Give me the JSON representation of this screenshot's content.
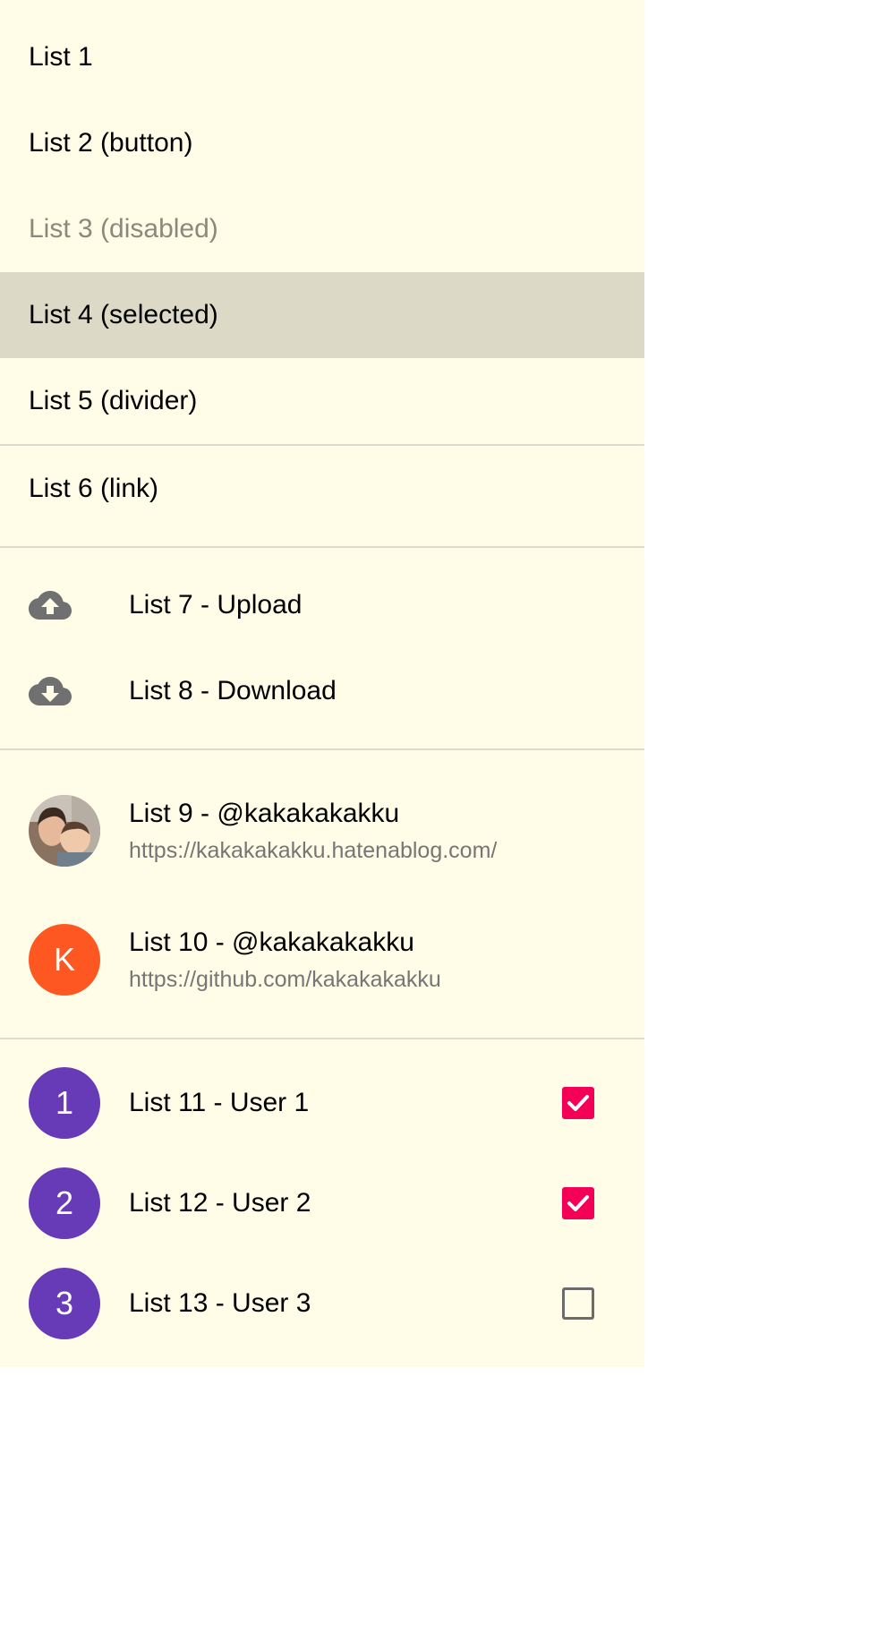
{
  "list": {
    "item1": "List 1",
    "item2": "List 2 (button)",
    "item3": "List 3 (disabled)",
    "item4": "List 4 (selected)",
    "item5": "List 5 (divider)",
    "item6": "List 6 (link)",
    "item7": "List 7 - Upload",
    "item8": "List 8 - Download",
    "item9": {
      "primary": "List 9 - @kakakakakku",
      "secondary": "https://kakakakakku.hatenablog.com/"
    },
    "item10": {
      "primary": "List 10 - @kakakakakku",
      "secondary": "https://github.com/kakakakakku",
      "avatar": "K",
      "avatar_color": "#ff5722"
    },
    "users": [
      {
        "label": "List 11 - User 1",
        "avatar": "1",
        "checked": true
      },
      {
        "label": "List 12 - User 2",
        "avatar": "2",
        "checked": true
      },
      {
        "label": "List 13 - User 3",
        "avatar": "3",
        "checked": false
      }
    ]
  },
  "icons": {
    "upload": "cloud-upload-icon",
    "download": "cloud-download-icon"
  },
  "colors": {
    "panel_background": "#fffde7",
    "selected_background": "#dcd9c6",
    "user_avatar": "#673ab7",
    "checkbox_checked": "#f50057",
    "icon_color": "#707070"
  }
}
